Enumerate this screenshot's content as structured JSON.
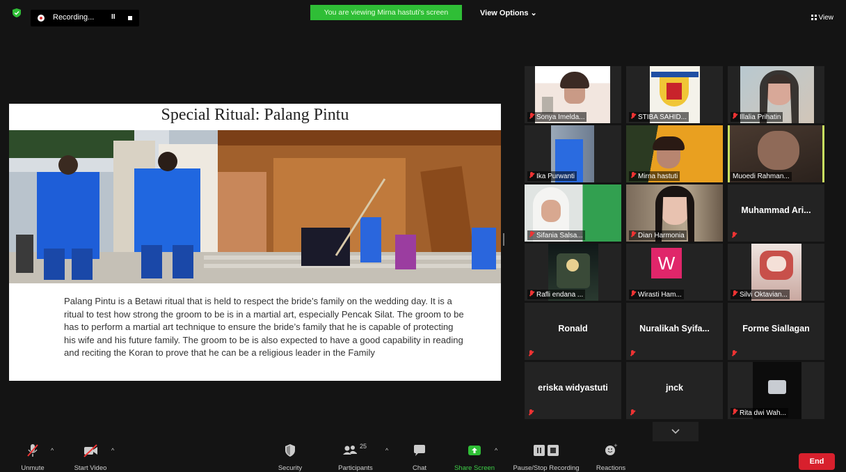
{
  "topbar": {
    "recording_label": "Recording...",
    "pause_glyph": "II",
    "viewing_banner": "You are viewing Mirna hastuti's screen",
    "view_options": "View Options ⌄",
    "view_label": "View"
  },
  "slide": {
    "title": "Special Ritual: Palang Pintu",
    "body": "Palang Pintu is a Betawi ritual that is held to respect the bride’s family on the wedding day. It is a ritual to test how strong the groom to be is in a martial art, especially Pencak Silat. The groom to be has to perform a martial art technique to ensure the bride’s family that he is capable of protecting his wife and his future family. The groom to be is also expected to have a good capability in reading and reciting the Koran to prove that he can be a religious leader in the Family"
  },
  "participants": [
    {
      "name": "Sonya Imelda...",
      "type": "video"
    },
    {
      "name": "STIBA SAHID...",
      "type": "video"
    },
    {
      "name": "Illalia Prihatin",
      "type": "video"
    },
    {
      "name": "Ika Purwanti",
      "type": "video"
    },
    {
      "name": "Mirna hastuti",
      "type": "video"
    },
    {
      "name": "Muoedi Rahman...",
      "type": "video",
      "active": true
    },
    {
      "name": "Sifania Salsa...",
      "type": "video"
    },
    {
      "name": "Dian Harmonia",
      "type": "video"
    },
    {
      "name": "Muhammad Ari...",
      "type": "name"
    },
    {
      "name": "Rafli endana ...",
      "type": "video"
    },
    {
      "name": "Wirasti Ham...",
      "type": "avatar",
      "avatar_letter": "W",
      "avatar_color": "#e0266a"
    },
    {
      "name": "Silvi Oktavian...",
      "type": "video"
    },
    {
      "name": "Ronald",
      "type": "name"
    },
    {
      "name": "Nuralikah Syifa...",
      "type": "name"
    },
    {
      "name": "Forme Siallagan",
      "type": "name"
    },
    {
      "name": "eriska widyastuti",
      "type": "name"
    },
    {
      "name": "jnck",
      "type": "name"
    },
    {
      "name": "Rita dwi Wah...",
      "type": "video"
    }
  ],
  "gallery_more": "⌄",
  "toolbar": {
    "unmute": "Unmute",
    "start_video": "Start Video",
    "security": "Security",
    "participants": "Participants",
    "participants_count": "25",
    "chat": "Chat",
    "share_screen": "Share Screen",
    "pause_recording": "Pause/Stop Recording",
    "reactions": "Reactions",
    "end": "End",
    "caret": "^"
  },
  "colors": {
    "viewing_banner": "#2fbe36",
    "share_screen": "#2fbe36",
    "end_button": "#d8202d",
    "active_speaker": "#c8e060",
    "muted_mic": "#ee3333"
  }
}
